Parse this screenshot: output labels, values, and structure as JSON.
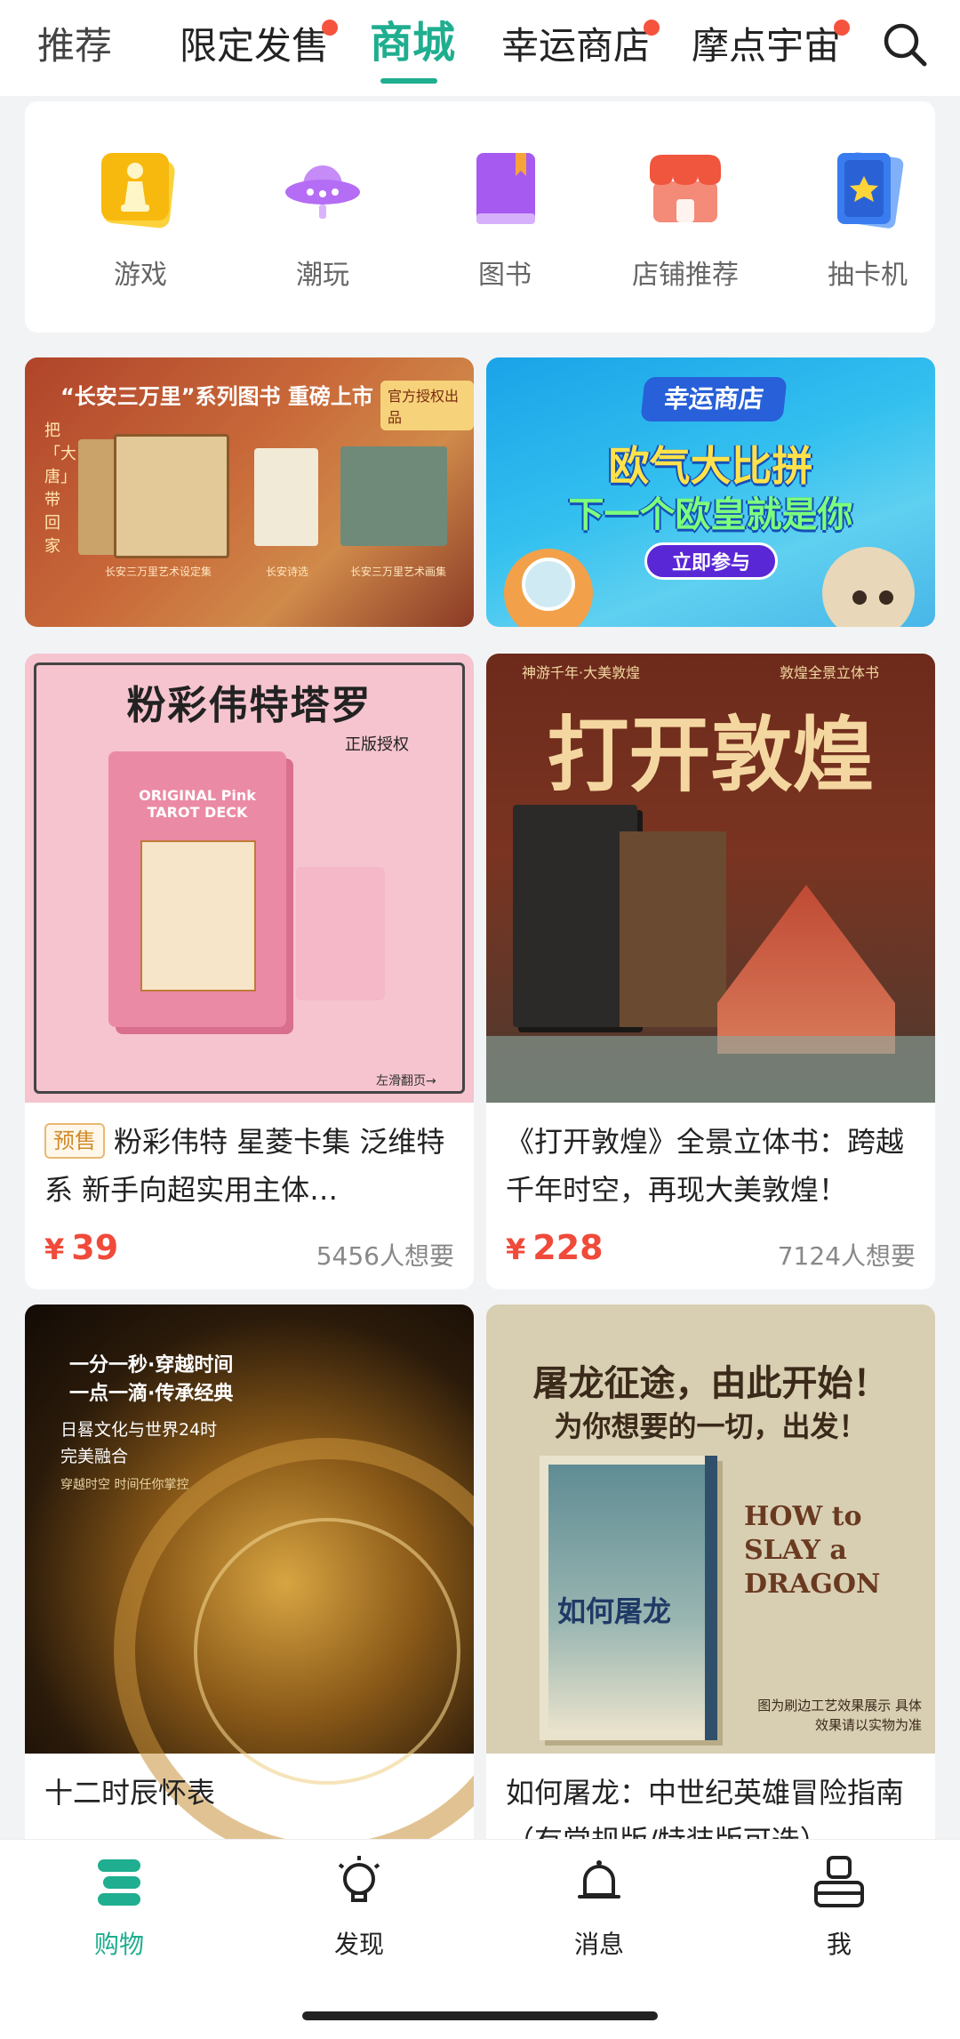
{
  "topTabs": {
    "tabs": [
      {
        "label": "推荐"
      },
      {
        "label": "限定发售",
        "dot": true
      },
      {
        "label": "商城",
        "active": true
      },
      {
        "label": "幸运商店",
        "dot": true
      },
      {
        "label": "摩点宇宙",
        "dot": true
      }
    ],
    "search_icon": "search-icon"
  },
  "categories": [
    {
      "label": "游戏",
      "icon": "chess-icon",
      "color": "#f8b90f"
    },
    {
      "label": "潮玩",
      "icon": "ufo-icon",
      "color": "#b46df4"
    },
    {
      "label": "图书",
      "icon": "book-icon",
      "color": "#a65af0"
    },
    {
      "label": "店铺推荐",
      "icon": "store-icon",
      "color": "#f06a55"
    },
    {
      "label": "抽卡机",
      "icon": "card-icon",
      "color": "#3a7cf0"
    }
  ],
  "banners": {
    "left": {
      "title": "“长安三万里”系列图书 重磅上市",
      "tag": "官方授权出品",
      "side": "把「大唐」带回家",
      "captions": [
        "长安三万里艺术设定集",
        "长安诗选",
        "长安三万里艺术画集"
      ]
    },
    "right": {
      "brand": "幸运商店",
      "headline1": "欧气大比拼",
      "headline2": "下一个欧皇就是你",
      "cta": "立即参与"
    }
  },
  "products": [
    {
      "badge": "预售",
      "title": "粉彩伟特 星菱卡集 泛维特系 新手向超实用主体…",
      "currency": "¥",
      "price": "39",
      "wants": "5456人想要",
      "art": {
        "headline": "粉彩伟特塔罗",
        "sub": "正版授权",
        "deck": "ORIGINAL Pink TAROT DECK",
        "foot": "左滑翻页→"
      }
    },
    {
      "title": "《打开敦煌》全景立体书：跨越千年时空，再现大美敦煌！",
      "currency": "¥",
      "price": "228",
      "wants": "7124人想要",
      "art": {
        "headline": "打开敦煌",
        "sub_left": "神游千年·大美敦煌",
        "sub_right": "敦煌全景立体书"
      }
    },
    {
      "title": "十二时辰怀表",
      "art": {
        "line1": "一分一秒·穿越时间",
        "line2": "一点一滴·传承经典",
        "line3": "日晷文化与世界24时",
        "line4": "完美融合",
        "line5": "穿越时空 时间任你掌控"
      }
    },
    {
      "title": "如何屠龙：中世纪英雄冒险指南（有常规版/特装版可选）",
      "art": {
        "line1": "屠龙征途，由此开始！",
        "line2": "为你想要的一切，出发！",
        "en": "HOW to SLAY a DRAGON",
        "book": "如何屠龙",
        "note": "图为刷边工艺效果展示 具体效果请以实物为准"
      }
    }
  ],
  "bottomNav": [
    {
      "label": "购物",
      "icon": "shopping-icon",
      "active": true
    },
    {
      "label": "发现",
      "icon": "lightbulb-icon"
    },
    {
      "label": "消息",
      "icon": "bell-icon"
    },
    {
      "label": "我",
      "icon": "profile-icon"
    }
  ],
  "colors": {
    "accent": "#1fae8f",
    "price": "#f04a3a",
    "dot": "#f5533d"
  }
}
